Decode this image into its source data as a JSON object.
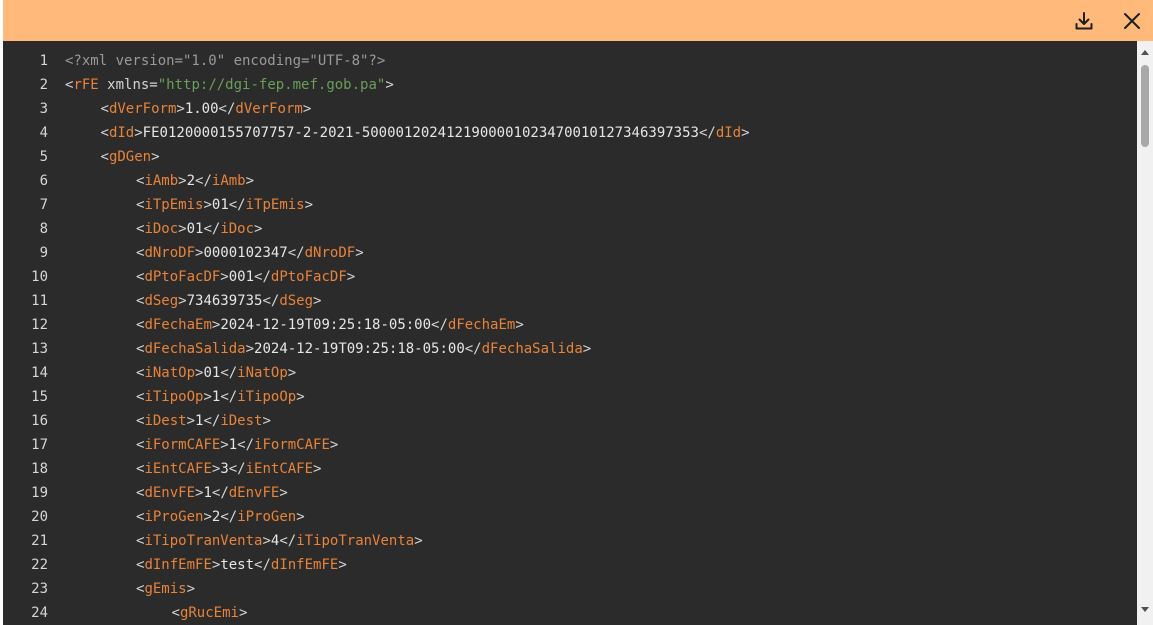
{
  "header": {
    "download_icon": "download-icon",
    "close_icon": "close-icon",
    "color": "#ffb97a"
  },
  "editor": {
    "background": "#2b2b2b",
    "lines": [
      {
        "n": "1",
        "indent": 0,
        "parts": [
          [
            "pi",
            "<?xml version=\"1.0\" encoding=\"UTF-8\"?>"
          ]
        ]
      },
      {
        "n": "2",
        "indent": 0,
        "parts": [
          [
            "br",
            "<"
          ],
          [
            "tag",
            "rFE"
          ],
          [
            "attr",
            " xmlns="
          ],
          [
            "val",
            "\"http://dgi-fep.mef.gob.pa\""
          ],
          [
            "br",
            ">"
          ]
        ]
      },
      {
        "n": "3",
        "indent": 1,
        "parts": [
          [
            "br",
            "<"
          ],
          [
            "tag",
            "dVerForm"
          ],
          [
            "br",
            ">"
          ],
          [
            "txt",
            "1.00"
          ],
          [
            "br",
            "</"
          ],
          [
            "tag",
            "dVerForm"
          ],
          [
            "br",
            ">"
          ]
        ]
      },
      {
        "n": "4",
        "indent": 1,
        "parts": [
          [
            "br",
            "<"
          ],
          [
            "tag",
            "dId"
          ],
          [
            "br",
            ">"
          ],
          [
            "txt",
            "FE0120000155707757-2-2021-5000012024121900001023470010127346397353"
          ],
          [
            "br",
            "</"
          ],
          [
            "tag",
            "dId"
          ],
          [
            "br",
            ">"
          ]
        ]
      },
      {
        "n": "5",
        "indent": 1,
        "parts": [
          [
            "br",
            "<"
          ],
          [
            "tag",
            "gDGen"
          ],
          [
            "br",
            ">"
          ]
        ]
      },
      {
        "n": "6",
        "indent": 2,
        "parts": [
          [
            "br",
            "<"
          ],
          [
            "tag",
            "iAmb"
          ],
          [
            "br",
            ">"
          ],
          [
            "txt",
            "2"
          ],
          [
            "br",
            "</"
          ],
          [
            "tag",
            "iAmb"
          ],
          [
            "br",
            ">"
          ]
        ]
      },
      {
        "n": "7",
        "indent": 2,
        "parts": [
          [
            "br",
            "<"
          ],
          [
            "tag",
            "iTpEmis"
          ],
          [
            "br",
            ">"
          ],
          [
            "txt",
            "01"
          ],
          [
            "br",
            "</"
          ],
          [
            "tag",
            "iTpEmis"
          ],
          [
            "br",
            ">"
          ]
        ]
      },
      {
        "n": "8",
        "indent": 2,
        "parts": [
          [
            "br",
            "<"
          ],
          [
            "tag",
            "iDoc"
          ],
          [
            "br",
            ">"
          ],
          [
            "txt",
            "01"
          ],
          [
            "br",
            "</"
          ],
          [
            "tag",
            "iDoc"
          ],
          [
            "br",
            ">"
          ]
        ]
      },
      {
        "n": "9",
        "indent": 2,
        "parts": [
          [
            "br",
            "<"
          ],
          [
            "tag",
            "dNroDF"
          ],
          [
            "br",
            ">"
          ],
          [
            "txt",
            "0000102347"
          ],
          [
            "br",
            "</"
          ],
          [
            "tag",
            "dNroDF"
          ],
          [
            "br",
            ">"
          ]
        ]
      },
      {
        "n": "10",
        "indent": 2,
        "parts": [
          [
            "br",
            "<"
          ],
          [
            "tag",
            "dPtoFacDF"
          ],
          [
            "br",
            ">"
          ],
          [
            "txt",
            "001"
          ],
          [
            "br",
            "</"
          ],
          [
            "tag",
            "dPtoFacDF"
          ],
          [
            "br",
            ">"
          ]
        ]
      },
      {
        "n": "11",
        "indent": 2,
        "parts": [
          [
            "br",
            "<"
          ],
          [
            "tag",
            "dSeg"
          ],
          [
            "br",
            ">"
          ],
          [
            "txt",
            "734639735"
          ],
          [
            "br",
            "</"
          ],
          [
            "tag",
            "dSeg"
          ],
          [
            "br",
            ">"
          ]
        ]
      },
      {
        "n": "12",
        "indent": 2,
        "parts": [
          [
            "br",
            "<"
          ],
          [
            "tag",
            "dFechaEm"
          ],
          [
            "br",
            ">"
          ],
          [
            "txt",
            "2024-12-19T09:25:18-05:00"
          ],
          [
            "br",
            "</"
          ],
          [
            "tag",
            "dFechaEm"
          ],
          [
            "br",
            ">"
          ]
        ]
      },
      {
        "n": "13",
        "indent": 2,
        "parts": [
          [
            "br",
            "<"
          ],
          [
            "tag",
            "dFechaSalida"
          ],
          [
            "br",
            ">"
          ],
          [
            "txt",
            "2024-12-19T09:25:18-05:00"
          ],
          [
            "br",
            "</"
          ],
          [
            "tag",
            "dFechaSalida"
          ],
          [
            "br",
            ">"
          ]
        ]
      },
      {
        "n": "14",
        "indent": 2,
        "parts": [
          [
            "br",
            "<"
          ],
          [
            "tag",
            "iNatOp"
          ],
          [
            "br",
            ">"
          ],
          [
            "txt",
            "01"
          ],
          [
            "br",
            "</"
          ],
          [
            "tag",
            "iNatOp"
          ],
          [
            "br",
            ">"
          ]
        ]
      },
      {
        "n": "15",
        "indent": 2,
        "parts": [
          [
            "br",
            "<"
          ],
          [
            "tag",
            "iTipoOp"
          ],
          [
            "br",
            ">"
          ],
          [
            "txt",
            "1"
          ],
          [
            "br",
            "</"
          ],
          [
            "tag",
            "iTipoOp"
          ],
          [
            "br",
            ">"
          ]
        ]
      },
      {
        "n": "16",
        "indent": 2,
        "parts": [
          [
            "br",
            "<"
          ],
          [
            "tag",
            "iDest"
          ],
          [
            "br",
            ">"
          ],
          [
            "txt",
            "1"
          ],
          [
            "br",
            "</"
          ],
          [
            "tag",
            "iDest"
          ],
          [
            "br",
            ">"
          ]
        ]
      },
      {
        "n": "17",
        "indent": 2,
        "parts": [
          [
            "br",
            "<"
          ],
          [
            "tag",
            "iFormCAFE"
          ],
          [
            "br",
            ">"
          ],
          [
            "txt",
            "1"
          ],
          [
            "br",
            "</"
          ],
          [
            "tag",
            "iFormCAFE"
          ],
          [
            "br",
            ">"
          ]
        ]
      },
      {
        "n": "18",
        "indent": 2,
        "parts": [
          [
            "br",
            "<"
          ],
          [
            "tag",
            "iEntCAFE"
          ],
          [
            "br",
            ">"
          ],
          [
            "txt",
            "3"
          ],
          [
            "br",
            "</"
          ],
          [
            "tag",
            "iEntCAFE"
          ],
          [
            "br",
            ">"
          ]
        ]
      },
      {
        "n": "19",
        "indent": 2,
        "parts": [
          [
            "br",
            "<"
          ],
          [
            "tag",
            "dEnvFE"
          ],
          [
            "br",
            ">"
          ],
          [
            "txt",
            "1"
          ],
          [
            "br",
            "</"
          ],
          [
            "tag",
            "dEnvFE"
          ],
          [
            "br",
            ">"
          ]
        ]
      },
      {
        "n": "20",
        "indent": 2,
        "parts": [
          [
            "br",
            "<"
          ],
          [
            "tag",
            "iProGen"
          ],
          [
            "br",
            ">"
          ],
          [
            "txt",
            "2"
          ],
          [
            "br",
            "</"
          ],
          [
            "tag",
            "iProGen"
          ],
          [
            "br",
            ">"
          ]
        ]
      },
      {
        "n": "21",
        "indent": 2,
        "parts": [
          [
            "br",
            "<"
          ],
          [
            "tag",
            "iTipoTranVenta"
          ],
          [
            "br",
            ">"
          ],
          [
            "txt",
            "4"
          ],
          [
            "br",
            "</"
          ],
          [
            "tag",
            "iTipoTranVenta"
          ],
          [
            "br",
            ">"
          ]
        ]
      },
      {
        "n": "22",
        "indent": 2,
        "parts": [
          [
            "br",
            "<"
          ],
          [
            "tag",
            "dInfEmFE"
          ],
          [
            "br",
            ">"
          ],
          [
            "txt",
            "test"
          ],
          [
            "br",
            "</"
          ],
          [
            "tag",
            "dInfEmFE"
          ],
          [
            "br",
            ">"
          ]
        ]
      },
      {
        "n": "23",
        "indent": 2,
        "parts": [
          [
            "br",
            "<"
          ],
          [
            "tag",
            "gEmis"
          ],
          [
            "br",
            ">"
          ]
        ]
      },
      {
        "n": "24",
        "indent": 3,
        "parts": [
          [
            "br",
            "<"
          ],
          [
            "tag",
            "gRucEmi"
          ],
          [
            "br",
            ">"
          ]
        ]
      }
    ]
  }
}
